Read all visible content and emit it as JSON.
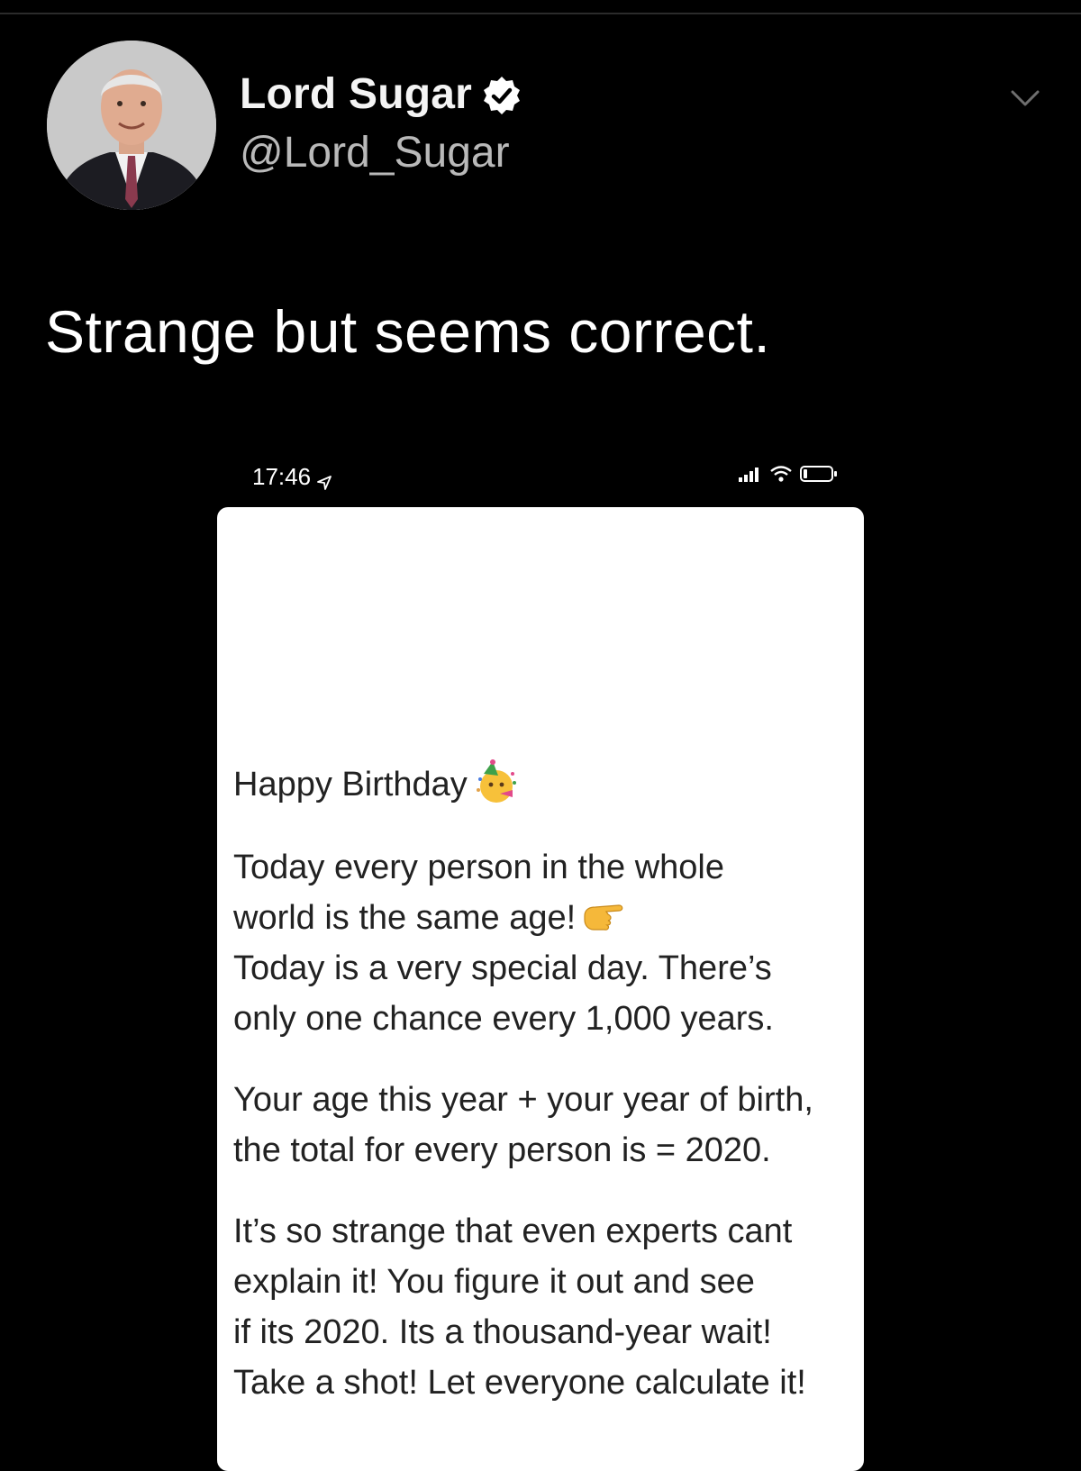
{
  "tweet": {
    "author": {
      "display_name": "Lord Sugar",
      "handle": "@Lord_Sugar",
      "verified": true
    },
    "text": "Strange but seems correct.",
    "menu_icon": "chevron-down-icon"
  },
  "embedded_screenshot": {
    "status_bar": {
      "time": "17:46",
      "icons": [
        "location-arrow-icon",
        "signal-icon",
        "wifi-icon",
        "battery-icon"
      ]
    },
    "message": {
      "greeting": "Happy Birthday",
      "greeting_emoji": "partying-face-icon",
      "line_1": "Today every person in the whole",
      "line_2": "world is the same age!",
      "line_2_emoji": "pointing-hand-icon",
      "line_3": "Today is a very special day. There’s",
      "line_4": "only one chance every 1,000 years.",
      "line_5": "Your age this year + your year of birth,",
      "line_6": "the total for every person is = 2020.",
      "line_7": "It’s so strange that even experts cant",
      "line_8": "explain it! You figure it out and see",
      "line_9": "if its 2020. Its a thousand-year wait!",
      "line_10": "Take a shot!  Let everyone calculate it!"
    }
  },
  "colors": {
    "background": "#000000",
    "text_primary": "#ffffff",
    "text_secondary": "#b9b9b9",
    "card_background": "#ffffff",
    "card_text": "#222222"
  }
}
